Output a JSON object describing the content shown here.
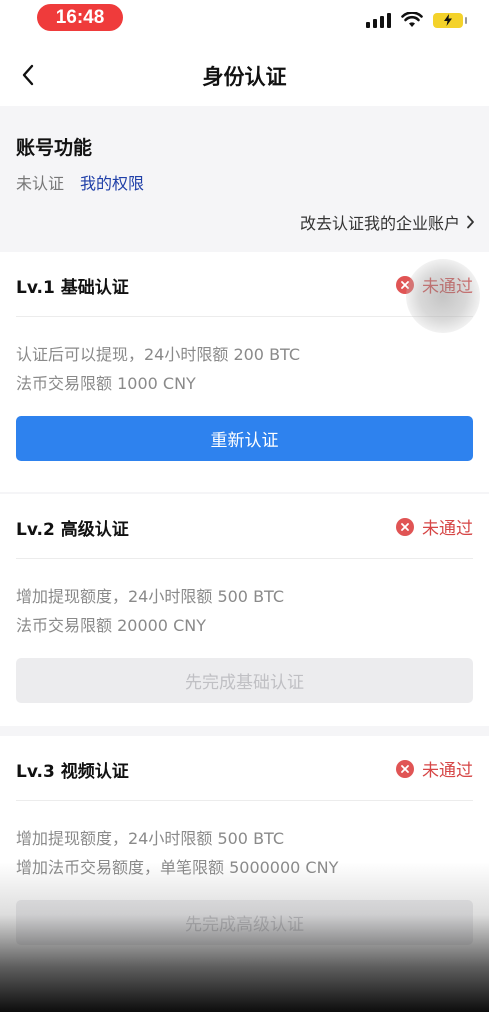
{
  "status_bar": {
    "time": "16:48",
    "icons": [
      "signal-icon",
      "wifi-icon",
      "battery-charging-icon"
    ]
  },
  "nav": {
    "title": "身份认证",
    "back_icon": "chevron-left-icon"
  },
  "account": {
    "title": "账号功能",
    "status": "未认证",
    "permissions_link": "我的权限",
    "enterprise_link": "改去认证我的企业账户"
  },
  "levels": [
    {
      "title": "Lv.1 基础认证",
      "status": "未通过",
      "desc_line1": "认证后可以提现，24小时限额 200 BTC",
      "desc_line2": "法币交易限额 1000 CNY",
      "button": "重新认证",
      "button_enabled": true
    },
    {
      "title": "Lv.2 高级认证",
      "status": "未通过",
      "desc_line1": "增加提现额度，24小时限额 500 BTC",
      "desc_line2": "法币交易限额 20000 CNY",
      "button": "先完成基础认证",
      "button_enabled": false
    },
    {
      "title": "Lv.3 视频认证",
      "status": "未通过",
      "desc_line1": "增加提现额度，24小时限额 500 BTC",
      "desc_line2": "增加法币交易额度，单笔限额 5000000 CNY",
      "button": "先完成高级认证",
      "button_enabled": false
    }
  ],
  "colors": {
    "primary": "#2e82ee",
    "link": "#1f3fa8",
    "error": "#d64646",
    "time_pill": "#ef3b3b"
  }
}
